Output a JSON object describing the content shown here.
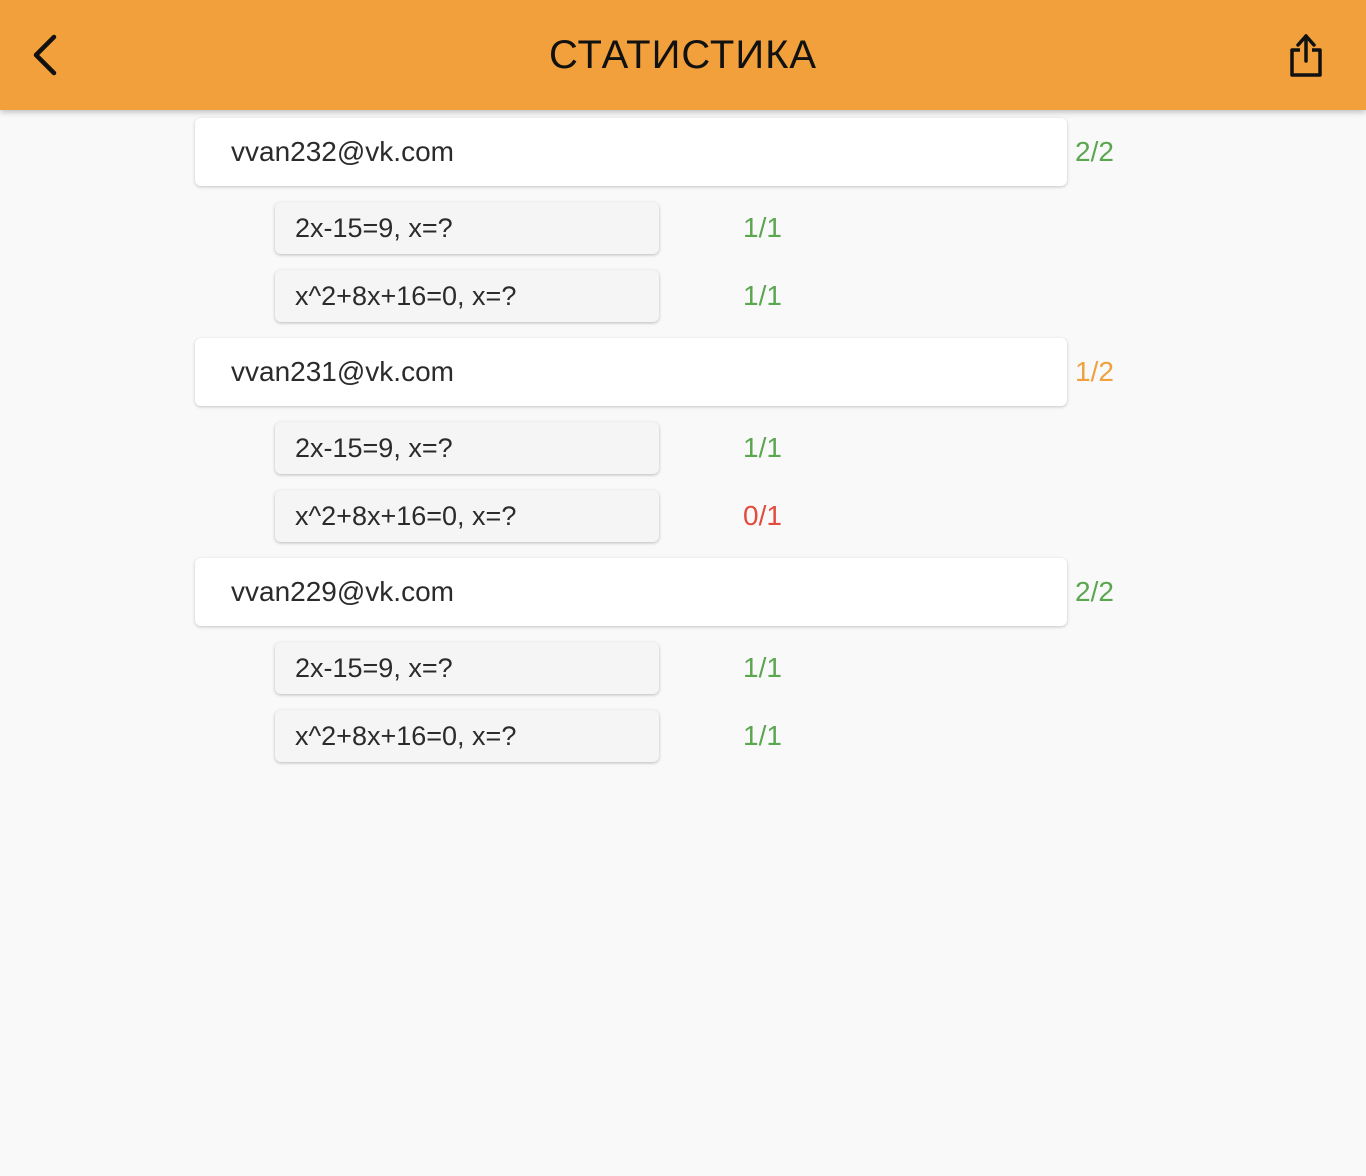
{
  "header": {
    "title": "СТАТИСТИКА",
    "back_icon": "chevron-left-icon",
    "share_icon": "share-icon",
    "background_color": "#f2a03b"
  },
  "status_colors": {
    "complete": "#5aa74f",
    "partial": "#f0a13f",
    "zero": "#e24b3d"
  },
  "users": [
    {
      "email": "vvan232@vk.com",
      "score": "2/2",
      "status": "complete",
      "tasks": [
        {
          "question": "2x-15=9, x=?",
          "score": "1/1",
          "status": "complete"
        },
        {
          "question": "x^2+8x+16=0, x=?",
          "score": "1/1",
          "status": "complete"
        }
      ]
    },
    {
      "email": "vvan231@vk.com",
      "score": "1/2",
      "status": "partial",
      "tasks": [
        {
          "question": "2x-15=9, x=?",
          "score": "1/1",
          "status": "complete"
        },
        {
          "question": "x^2+8x+16=0, x=?",
          "score": "0/1",
          "status": "zero"
        }
      ]
    },
    {
      "email": "vvan229@vk.com",
      "score": "2/2",
      "status": "complete",
      "tasks": [
        {
          "question": "2x-15=9, x=?",
          "score": "1/1",
          "status": "complete"
        },
        {
          "question": "x^2+8x+16=0, x=?",
          "score": "1/1",
          "status": "complete"
        }
      ]
    }
  ]
}
